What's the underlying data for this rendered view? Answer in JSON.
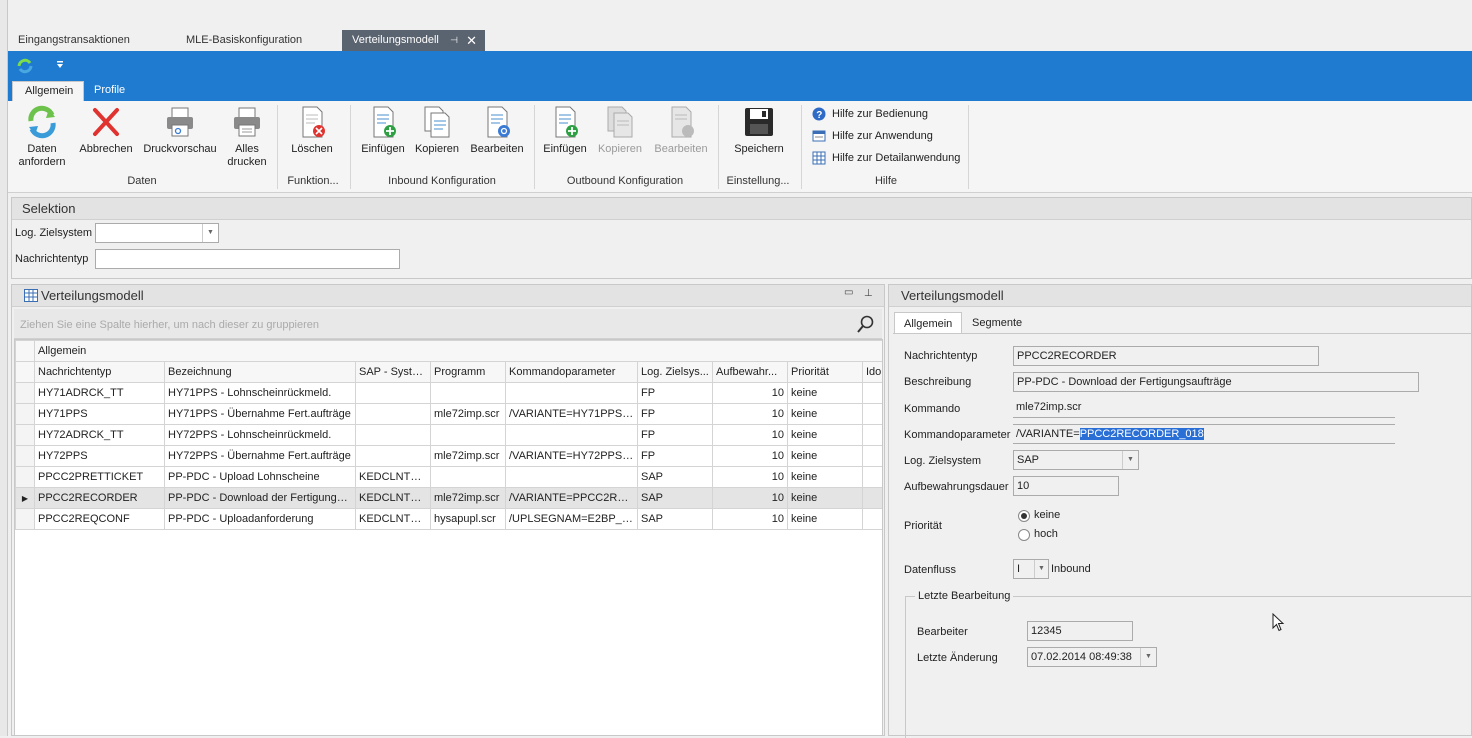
{
  "doc_tabs": {
    "tab1": "Eingangstransaktionen",
    "tab2": "MLE-Basiskonfiguration",
    "tab3": "Verteilungsmodell",
    "pin": "⊣",
    "close": "✕"
  },
  "ribbon": {
    "tabs": {
      "allgemein": "Allgemein",
      "profile": "Profile"
    },
    "buttons": {
      "daten_anfordern": "Daten\nanfordern",
      "abbrechen": "Abbrechen",
      "druckvorschau": "Druckvorschau",
      "alles_drucken": "Alles\ndrucken",
      "loeschen": "Löschen",
      "in_einfuegen": "Einfügen",
      "in_kopieren": "Kopieren",
      "in_bearbeiten": "Bearbeiten",
      "out_einfuegen": "Einfügen",
      "out_kopieren": "Kopieren",
      "out_bearbeiten": "Bearbeiten",
      "speichern": "Speichern"
    },
    "groups": {
      "daten": "Daten",
      "funktion": "Funktion...",
      "inbound": "Inbound Konfiguration",
      "outbound": "Outbound Konfiguration",
      "einstellung": "Einstellung...",
      "hilfe": "Hilfe"
    },
    "help_links": {
      "bedienung": "Hilfe zur Bedienung",
      "anwendung": "Hilfe zur Anwendung",
      "detail": "Hilfe zur Detailanwendung"
    },
    "colors": {
      "ribbon_blue": "#1e7bd0",
      "delete_red": "#e0322e",
      "add_green": "#2ea043"
    }
  },
  "selektion": {
    "title": "Selektion",
    "ziel_label": "Log. Zielsystem",
    "ziel_value": "",
    "nachricht_label": "Nachrichtentyp",
    "nachricht_value": ""
  },
  "grid_panel": {
    "title": "Verteilungsmodell",
    "group_hint": "Ziehen Sie eine Spalte hierher, um nach dieser zu gruppieren",
    "band": "Allgemein",
    "columns": {
      "c1": "Nachrichtentyp",
      "c2": "Bezeichnung",
      "c3": "SAP - System",
      "c4": "Programm",
      "c5": "Kommandoparameter",
      "c6": "Log. Zielsys...",
      "c7": "Aufbewahr...",
      "c8": "Priorität",
      "c9": "Ido"
    },
    "rows": [
      {
        "c1": "HY71ADRCK_TT",
        "c2": "HY71PPS - Lohnscheinrückmeld.",
        "c3": "",
        "c4": "",
        "c5": "",
        "c6": "FP",
        "c7": "10",
        "c8": "keine"
      },
      {
        "c1": "HY71PPS",
        "c2": "HY71PPS - Übernahme Fert.aufträge",
        "c3": "",
        "c4": "mle72imp.scr",
        "c5": "/VARIANTE=HY71PPS_...",
        "c6": "FP",
        "c7": "10",
        "c8": "keine"
      },
      {
        "c1": "HY72ADRCK_TT",
        "c2": "HY72PPS - Lohnscheinrückmeld.",
        "c3": "",
        "c4": "",
        "c5": "",
        "c6": "FP",
        "c7": "10",
        "c8": "keine"
      },
      {
        "c1": "HY72PPS",
        "c2": "HY72PPS - Übernahme Fert.aufträge",
        "c3": "",
        "c4": "mle72imp.scr",
        "c5": "/VARIANTE=HY72PPS_...",
        "c6": "FP",
        "c7": "10",
        "c8": "keine"
      },
      {
        "c1": "PPCC2PRETTICKET",
        "c2": "PP-PDC - Upload Lohnscheine",
        "c3": "KEDCLNT200",
        "c4": "",
        "c5": "",
        "c6": "SAP",
        "c7": "10",
        "c8": "keine"
      },
      {
        "c1": "PPCC2RECORDER",
        "c2": "PP-PDC - Download der Fertigungsa...",
        "c3": "KEDCLNT200",
        "c4": "mle72imp.scr",
        "c5": "/VARIANTE=PPCC2REC...",
        "c6": "SAP",
        "c7": "10",
        "c8": "keine"
      },
      {
        "c1": "PPCC2REQCONF",
        "c2": "PP-PDC - Uploadanforderung",
        "c3": "KEDCLNT200",
        "c4": "hysapupl.scr",
        "c5": "/UPLSEGNAM=E2BP_PP...",
        "c6": "SAP",
        "c7": "10",
        "c8": "keine"
      }
    ],
    "selected_row": 5
  },
  "detail": {
    "title": "Verteilungsmodell",
    "tabs": {
      "allgemein": "Allgemein",
      "segmente": "Segmente"
    },
    "nachrichtentyp_label": "Nachrichtentyp",
    "nachrichtentyp": "PPCC2RECORDER",
    "beschreibung_label": "Beschreibung",
    "beschreibung": "PP-PDC - Download der Fertigungsaufträge",
    "kommando_label": "Kommando",
    "kommando": "mle72imp.scr",
    "kommandoparameter_label": "Kommandoparameter",
    "kommandoparameter_prefix": "/VARIANTE=",
    "kommandoparameter_selected": "PPCC2RECORDER_018",
    "ziel_label": "Log. Zielsystem",
    "ziel": "SAP",
    "aufbewahrung_label": "Aufbewahrungsdauer",
    "aufbewahrung": "10",
    "prioritaet_label": "Priorität",
    "prio_keine": "keine",
    "prio_hoch": "hoch",
    "prio_selected": "keine",
    "datenfluss_label": "Datenfluss",
    "datenfluss_code": "I",
    "datenfluss_text": "Inbound",
    "letzte_group": "Letzte Bearbeitung",
    "bearbeiter_label": "Bearbeiter",
    "bearbeiter": "12345",
    "aenderung_label": "Letzte Änderung",
    "aenderung": "07.02.2014 08:49:38"
  }
}
